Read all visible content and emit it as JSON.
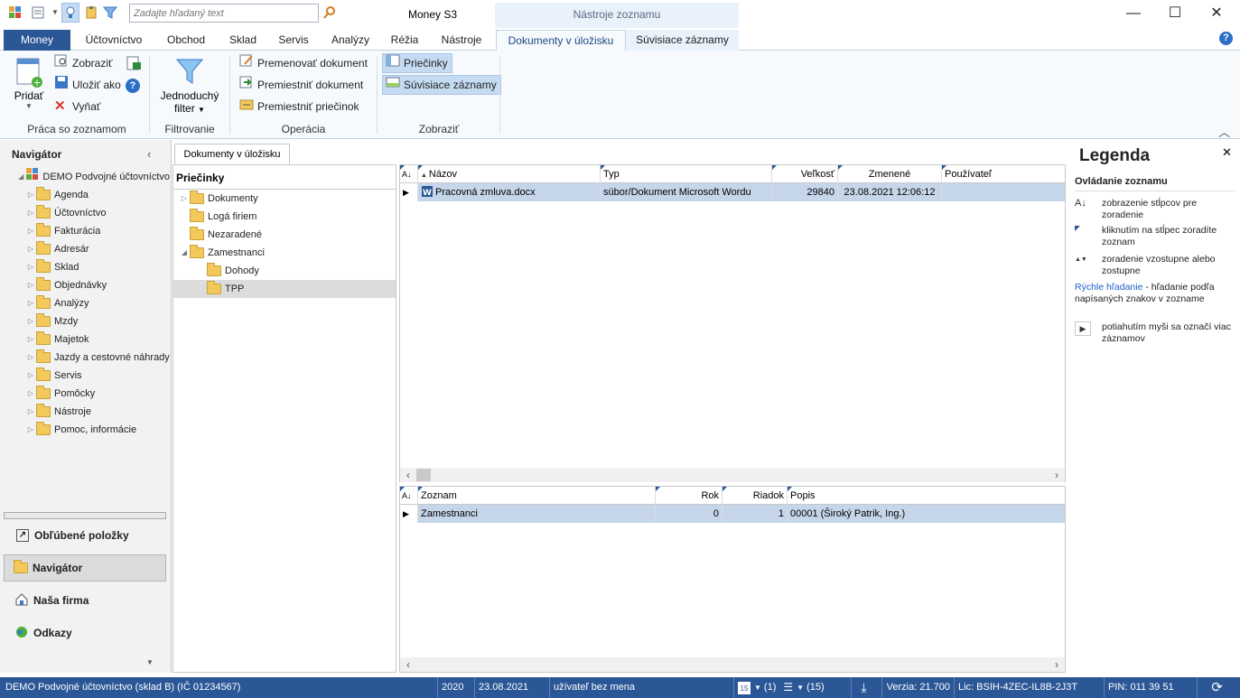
{
  "titlebar": {
    "search_placeholder": "Zadajte hľadaný text",
    "app_title": "Money S3",
    "context_title": "Nástroje zoznamu"
  },
  "tabs": {
    "money": "Money",
    "items": [
      "Účtovníctvo",
      "Obchod",
      "Sklad",
      "Servis",
      "Analýzy",
      "Réžia",
      "Nástroje",
      "Dokumenty v úložisku",
      "Súvisiace záznamy"
    ]
  },
  "ribbon": {
    "pridat": "Pridať",
    "zobrazit": "Zobraziť",
    "ulozit_ako": "Uložiť ako",
    "vyňat": "Vyňať",
    "group_praca": "Práca so zoznamom",
    "jednoduchy": "Jednoduchý",
    "filter": "filter",
    "group_filtrovanie": "Filtrovanie",
    "premenovat": "Premenovať dokument",
    "premiestnit_dok": "Premiestniť dokument",
    "premiestnit_prie": "Premiestniť priečinok",
    "group_operacia": "Operácia",
    "prieciny": "Priečinky",
    "suvisiace": "Súvisiace záznamy",
    "group_zobrazit": "Zobraziť"
  },
  "navigator": {
    "title": "Navigátor",
    "root": "DEMO Podvojné účtovníctvo",
    "items": [
      "Agenda",
      "Účtovníctvo",
      "Fakturácia",
      "Adresár",
      "Sklad",
      "Objednávky",
      "Analýzy",
      "Mzdy",
      "Majetok",
      "Jazdy a cestovné náhrady",
      "Servis",
      "Pomôcky",
      "Nástroje",
      "Pomoc, informácie"
    ],
    "bottom": [
      "Obľúbené položky",
      "Navigátor",
      "Naša firma",
      "Odkazy"
    ]
  },
  "folders": {
    "tab": "Dokumenty v úložisku",
    "title": "Priečinky",
    "items": [
      "Dokumenty",
      "Logá firiem",
      "Nezaradené",
      "Zamestnanci",
      "Dohody",
      "TPP"
    ]
  },
  "grid1": {
    "headers": [
      "Názov",
      "Typ",
      "Veľkosť",
      "Zmenené",
      "Používateľ"
    ],
    "row": {
      "nazov": "Pracovná zmluva.docx",
      "typ": "súbor/Dokument Microsoft Wordu",
      "velkost": "29840",
      "zmenene": "23.08.2021 12:06:12",
      "pouzivatel": ""
    }
  },
  "grid2": {
    "headers": [
      "Zoznam",
      "Rok",
      "Riadok",
      "Popis"
    ],
    "row": {
      "zoznam": "Zamestnanci",
      "rok": "0",
      "riadok": "1",
      "popis": "00001 (Široký Patrik, Ing.)"
    }
  },
  "legend": {
    "title": "Legenda",
    "subtitle": "Ovládanie zoznamu",
    "rows": [
      "zobrazenie stĺpcov pre zoradenie",
      "kliknutím na stĺpec zoradíte zoznam",
      "zoradenie vzostupne alebo zostupne",
      "potiahutím myši sa označí viac záznamov"
    ],
    "quick_link": "Rýchle hľadanie",
    "quick_text": " - hľadanie podľa napísaných znakov v zozname"
  },
  "status": {
    "company": "DEMO Podvojné účtovníctvo (sklad B) (IČ 01234567)",
    "year": "2020",
    "date": "23.08.2021",
    "user": "užívateľ bez mena",
    "cal_count": "(1)",
    "rss_count": "(15)",
    "version": "Verzia: 21.700",
    "license": "Lic: BSIH-4ZEC-IL8B-2J3T",
    "pin": "PIN: 011 39 51"
  }
}
